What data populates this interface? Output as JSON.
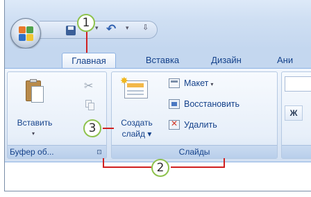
{
  "qat": {
    "office_button": "office-logo-icon",
    "save_icon": "save-icon",
    "undo_icon": "undo-icon",
    "dropdown_glyph": "▾",
    "undo_glyph": "↶",
    "customize_glyph": "⇩"
  },
  "tabs": [
    {
      "label": "Главная",
      "active": true
    },
    {
      "label": "Вставка",
      "active": false
    },
    {
      "label": "Дизайн",
      "active": false
    },
    {
      "label": "Ани",
      "active": false
    }
  ],
  "clipboard_group": {
    "paste_label": "Вставить",
    "paste_arrow": "▾",
    "cut_glyph": "✂",
    "label": "Буфер об...",
    "launcher_glyph": "⊡"
  },
  "slides_group": {
    "new_slide_line1": "Создать",
    "new_slide_line2": "слайд ▾",
    "layout_label": "Макет",
    "layout_arrow": "▾",
    "reset_label": "Восстановить",
    "delete_label": "Удалить",
    "label": "Слайды",
    "star_glyph": "✸"
  },
  "font_group": {
    "bold_label": "Ж"
  },
  "callouts": [
    "1",
    "2",
    "3"
  ],
  "colors": {
    "accent_text": "#15428b",
    "callout_border": "#8ec24d",
    "callout_line": "#d02020"
  }
}
